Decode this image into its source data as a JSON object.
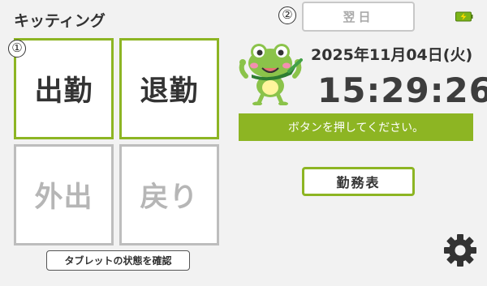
{
  "app": {
    "title": "キッティング"
  },
  "markers": {
    "one": "①",
    "two": "②"
  },
  "tiles": {
    "clock_in": "出勤",
    "clock_out": "退勤",
    "go_out": "外出",
    "return": "戻り"
  },
  "status_button_label": "タブレットの状態を確認",
  "next_day_label": "翌日",
  "datetime": {
    "date": "2025年11月04日(火)",
    "time": "15:29:26"
  },
  "banner_text": "ボタンを押してください。",
  "timesheet_label": "勤務表",
  "icons": {
    "battery": "battery-charging-icon",
    "mascot": "frog-mascot",
    "settings": "gear-icon"
  },
  "colors": {
    "accent": "#8db523",
    "disabled": "#bdbdbd",
    "background": "#f2f2f2"
  }
}
